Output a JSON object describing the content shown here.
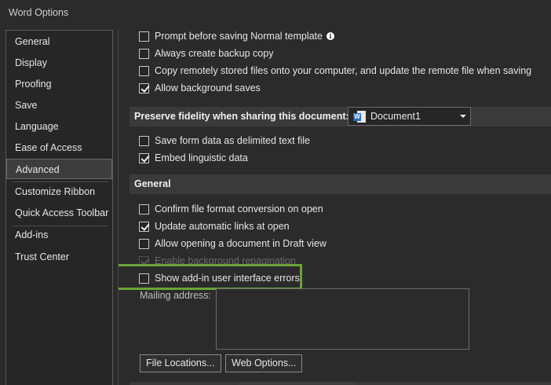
{
  "window": {
    "title": "Word Options"
  },
  "sidebar": {
    "items": [
      {
        "label": "General"
      },
      {
        "label": "Display"
      },
      {
        "label": "Proofing"
      },
      {
        "label": "Save"
      },
      {
        "label": "Language"
      },
      {
        "label": "Ease of Access"
      },
      {
        "label": "Advanced",
        "selected": true
      },
      {
        "label": "Customize Ribbon"
      },
      {
        "label": "Quick Access Toolbar"
      },
      {
        "label": "Add-ins"
      },
      {
        "label": "Trust Center"
      }
    ]
  },
  "save_options": [
    {
      "label": "Prompt before saving Normal template",
      "checked": false,
      "info": true
    },
    {
      "label": "Always create backup copy",
      "checked": false
    },
    {
      "label": "Copy remotely stored files onto your computer, and update the remote file when saving",
      "checked": false
    },
    {
      "label": "Allow background saves",
      "checked": true
    }
  ],
  "fidelity": {
    "header": "Preserve fidelity when sharing this document:",
    "document": "Document1",
    "options": [
      {
        "label": "Save form data as delimited text file",
        "checked": false
      },
      {
        "label": "Embed linguistic data",
        "checked": true
      }
    ]
  },
  "general": {
    "header": "General",
    "options": [
      {
        "label": "Confirm file format conversion on open",
        "checked": false
      },
      {
        "label": "Update automatic links at open",
        "checked": true
      },
      {
        "label": "Allow opening a document in Draft view",
        "checked": false
      },
      {
        "label": "Enable background repagination",
        "checked": true,
        "disabled": true
      },
      {
        "label": "Show add-in user interface errors",
        "checked": false,
        "highlighted": true
      }
    ],
    "mailing_address_label": "Mailing address:",
    "mailing_address_value": "",
    "file_locations_button": "File Locations...",
    "web_options_button": "Web Options..."
  },
  "colors": {
    "highlight": "#6aa437",
    "word_blue": "#2b6bc2"
  }
}
